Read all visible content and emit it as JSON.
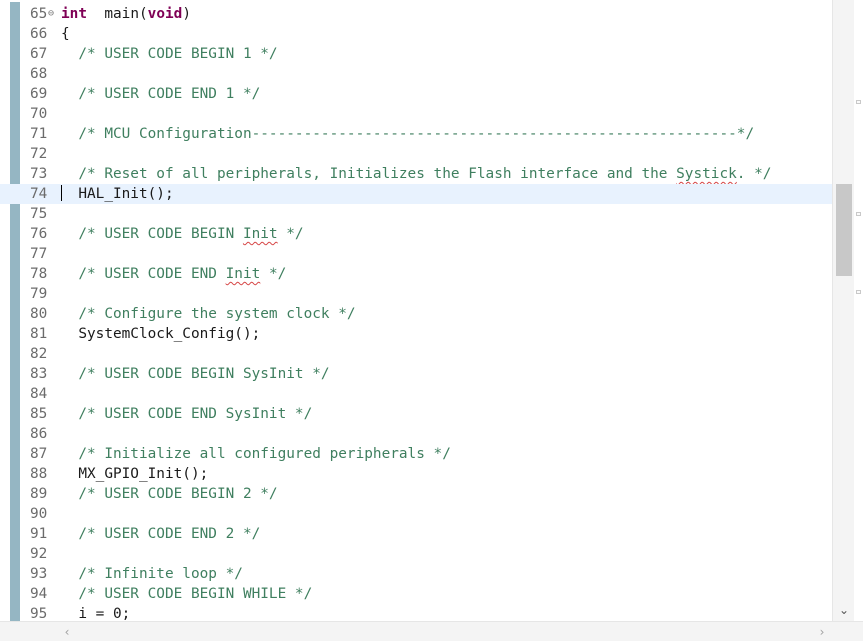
{
  "editor": {
    "current_line": "74",
    "lines": [
      {
        "n": "65",
        "segments": [
          [
            "kw",
            "int"
          ],
          [
            "",
            "  main("
          ],
          [
            "kw",
            "void"
          ],
          [
            "",
            ")"
          ]
        ],
        "fold": true
      },
      {
        "n": "66",
        "segments": [
          [
            "",
            "{"
          ]
        ]
      },
      {
        "n": "67",
        "segments": [
          [
            "",
            "  "
          ],
          [
            "cm",
            "/* USER CODE BEGIN 1 */"
          ]
        ]
      },
      {
        "n": "68",
        "segments": []
      },
      {
        "n": "69",
        "segments": [
          [
            "",
            "  "
          ],
          [
            "cm",
            "/* USER CODE END 1 */"
          ]
        ]
      },
      {
        "n": "70",
        "segments": []
      },
      {
        "n": "71",
        "segments": [
          [
            "",
            "  "
          ],
          [
            "cm",
            "/* MCU Configuration--------------------------------------------------------*/"
          ]
        ]
      },
      {
        "n": "72",
        "segments": []
      },
      {
        "n": "73",
        "segments": [
          [
            "",
            "  "
          ],
          [
            "cm",
            "/* Reset of all peripherals, Initializes the Flash interface and the "
          ],
          [
            "cm squig",
            "Systick"
          ],
          [
            "cm",
            ". */"
          ]
        ]
      },
      {
        "n": "74",
        "segments": [
          [
            "cursor",
            ""
          ],
          [
            "",
            "  HAL_Init();"
          ]
        ],
        "current": true
      },
      {
        "n": "75",
        "segments": []
      },
      {
        "n": "76",
        "segments": [
          [
            "",
            "  "
          ],
          [
            "cm",
            "/* USER CODE BEGIN "
          ],
          [
            "cm squig",
            "Init"
          ],
          [
            "cm",
            " */"
          ]
        ]
      },
      {
        "n": "77",
        "segments": []
      },
      {
        "n": "78",
        "segments": [
          [
            "",
            "  "
          ],
          [
            "cm",
            "/* USER CODE END "
          ],
          [
            "cm squig",
            "Init"
          ],
          [
            "cm",
            " */"
          ]
        ]
      },
      {
        "n": "79",
        "segments": []
      },
      {
        "n": "80",
        "segments": [
          [
            "",
            "  "
          ],
          [
            "cm",
            "/* Configure the system clock */"
          ]
        ]
      },
      {
        "n": "81",
        "segments": [
          [
            "",
            "  SystemClock_Config();"
          ]
        ]
      },
      {
        "n": "82",
        "segments": []
      },
      {
        "n": "83",
        "segments": [
          [
            "",
            "  "
          ],
          [
            "cm",
            "/* USER CODE BEGIN SysInit */"
          ]
        ]
      },
      {
        "n": "84",
        "segments": []
      },
      {
        "n": "85",
        "segments": [
          [
            "",
            "  "
          ],
          [
            "cm",
            "/* USER CODE END SysInit */"
          ]
        ]
      },
      {
        "n": "86",
        "segments": []
      },
      {
        "n": "87",
        "segments": [
          [
            "",
            "  "
          ],
          [
            "cm",
            "/* Initialize all configured peripherals */"
          ]
        ]
      },
      {
        "n": "88",
        "segments": [
          [
            "",
            "  MX_GPIO_Init();"
          ]
        ]
      },
      {
        "n": "89",
        "segments": [
          [
            "",
            "  "
          ],
          [
            "cm",
            "/* USER CODE BEGIN 2 */"
          ]
        ]
      },
      {
        "n": "90",
        "segments": []
      },
      {
        "n": "91",
        "segments": [
          [
            "",
            "  "
          ],
          [
            "cm",
            "/* USER CODE END 2 */"
          ]
        ]
      },
      {
        "n": "92",
        "segments": []
      },
      {
        "n": "93",
        "segments": [
          [
            "",
            "  "
          ],
          [
            "cm",
            "/* Infinite loop */"
          ]
        ]
      },
      {
        "n": "94",
        "segments": [
          [
            "",
            "  "
          ],
          [
            "cm",
            "/* USER CODE BEGIN WHILE */"
          ]
        ]
      },
      {
        "n": "95",
        "segments": [
          [
            "",
            "  i = 0;"
          ]
        ]
      }
    ]
  },
  "icons": {
    "fold": "fold-collapse-icon",
    "exec_arrow": "instruction-pointer-icon",
    "scroll_down": "chevron-down-icon",
    "scroll_left": "chevron-left-icon",
    "scroll_right": "chevron-right-icon"
  },
  "glyphs": {
    "fold": "⊖",
    "exec_arrow": "⇨",
    "scroll_down": "⌄",
    "scroll_left": "‹",
    "scroll_right": "›"
  },
  "colors": {
    "keyword": "#7f0055",
    "comment": "#3f7f5f",
    "current_line_bg": "#e8f2fe",
    "change_bar": "#82a9b8"
  }
}
